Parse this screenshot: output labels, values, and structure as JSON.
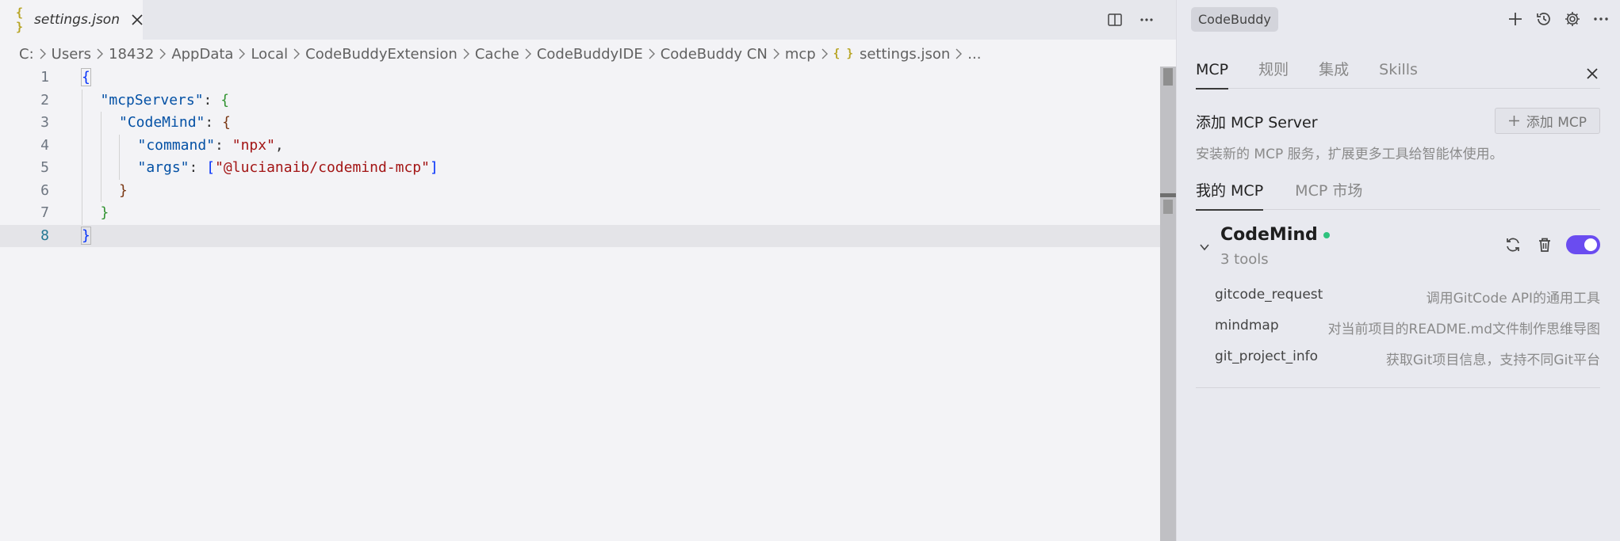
{
  "editor": {
    "tab": {
      "file_icon": "{ }",
      "filename": "settings.json"
    },
    "tab_actions": [
      "split-editor-icon",
      "more-actions-icon"
    ],
    "breadcrumb": [
      "C:",
      "Users",
      "18432",
      "AppData",
      "Local",
      "CodeBuddyExtension",
      "Cache",
      "CodeBuddyIDE",
      "CodeBuddy CN",
      "mcp",
      "settings.json",
      "..."
    ],
    "breadcrumb_file_icon": "{ }",
    "lines": [
      {
        "n": "1",
        "indent": 0,
        "tokens": [
          {
            "t": "{",
            "c": "b1"
          }
        ]
      },
      {
        "n": "2",
        "indent": 1,
        "tokens": [
          {
            "t": "\"mcpServers\"",
            "c": "k"
          },
          {
            "t": ": ",
            "c": "p"
          },
          {
            "t": "{",
            "c": "b2"
          }
        ]
      },
      {
        "n": "3",
        "indent": 2,
        "tokens": [
          {
            "t": "\"CodeMind\"",
            "c": "k"
          },
          {
            "t": ": ",
            "c": "p"
          },
          {
            "t": "{",
            "c": "b3"
          }
        ]
      },
      {
        "n": "4",
        "indent": 3,
        "tokens": [
          {
            "t": "\"command\"",
            "c": "k"
          },
          {
            "t": ": ",
            "c": "p"
          },
          {
            "t": "\"npx\"",
            "c": "s"
          },
          {
            "t": ",",
            "c": "p"
          }
        ]
      },
      {
        "n": "5",
        "indent": 3,
        "tokens": [
          {
            "t": "\"args\"",
            "c": "k"
          },
          {
            "t": ": ",
            "c": "p"
          },
          {
            "t": "[",
            "c": "b1"
          },
          {
            "t": "\"@lucianaib/codemind-mcp\"",
            "c": "s"
          },
          {
            "t": "]",
            "c": "b1"
          }
        ]
      },
      {
        "n": "6",
        "indent": 2,
        "tokens": [
          {
            "t": "}",
            "c": "b3"
          }
        ]
      },
      {
        "n": "7",
        "indent": 1,
        "tokens": [
          {
            "t": "}",
            "c": "b2"
          }
        ]
      },
      {
        "n": "8",
        "indent": 0,
        "tokens": [
          {
            "t": "}",
            "c": "b1"
          }
        ],
        "current": true
      }
    ]
  },
  "panel": {
    "badge": "CodeBuddy",
    "top_icons": [
      "plus-icon",
      "history-icon",
      "gear-icon",
      "more-icon"
    ],
    "tabs": [
      {
        "label": "MCP",
        "active": true
      },
      {
        "label": "规则",
        "active": false
      },
      {
        "label": "集成",
        "active": false
      },
      {
        "label": "Skills",
        "active": false
      }
    ],
    "add_title": "添加 MCP Server",
    "add_button": "添加 MCP",
    "add_desc": "安装新的 MCP 服务，扩展更多工具给智能体使用。",
    "subtabs": [
      {
        "label": "我的 MCP",
        "active": true
      },
      {
        "label": "MCP 市场",
        "active": false
      }
    ],
    "server": {
      "name": "CodeMind",
      "status_color": "#2ec27e",
      "tool_count": "3 tools",
      "enabled": true,
      "toggle_color": "#6a4cf0",
      "tools": [
        {
          "name": "gitcode_request",
          "desc": "调用GitCode API的通用工具"
        },
        {
          "name": "mindmap",
          "desc": "对当前项目的README.md文件制作思维导图"
        },
        {
          "name": "git_project_info",
          "desc": "获取Git项目信息，支持不同Git平台"
        }
      ]
    }
  }
}
